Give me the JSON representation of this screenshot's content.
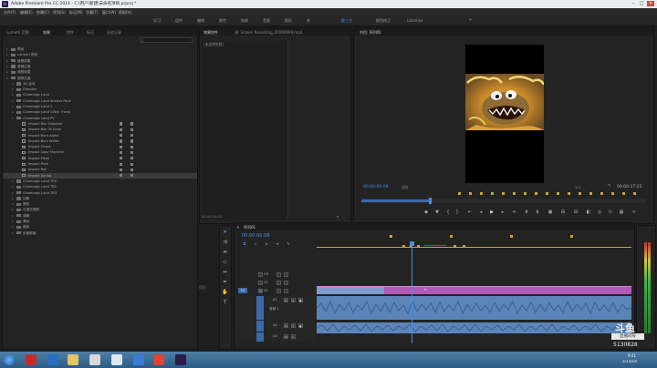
{
  "window": {
    "title": "Adobe Premiere Pro CC 2014 - C:\\用户\\新建\\未命名项目.prproj *",
    "minimize": "–",
    "maximize": "□",
    "close": "✕"
  },
  "menu": [
    "文件(F)",
    "编辑(E)",
    "剪辑(C)",
    "序列(S)",
    "标记(M)",
    "字幕(T)",
    "窗口(W)",
    "帮助(H)"
  ],
  "workspaces": {
    "items": [
      "学习",
      "组件",
      "编辑",
      "颜色",
      "效果",
      "音频",
      "图形",
      "库",
      "第三方",
      "颜色校正",
      "Libraries"
    ],
    "active": "第三方"
  },
  "effects_panel": {
    "tabs": [
      "Lumetri 范围",
      "效果",
      "控件",
      "标记",
      "历史记录"
    ],
    "active_tab": "效果",
    "search_icon": "search-icon",
    "tree": [
      {
        "label": "预设",
        "level": 0,
        "kind": "folder"
      },
      {
        "label": "Lumetri 预设",
        "level": 0,
        "kind": "folder"
      },
      {
        "label": "音频效果",
        "level": 0,
        "kind": "folder"
      },
      {
        "label": "音频过渡",
        "level": 0,
        "kind": "folder"
      },
      {
        "label": "视频效果",
        "level": 0,
        "kind": "folder"
      },
      {
        "label": "视频过渡",
        "level": 0,
        "kind": "folder",
        "open": true
      },
      {
        "label": "3D 运动",
        "level": 1,
        "kind": "folder"
      },
      {
        "label": "Dissolve",
        "level": 1,
        "kind": "folder"
      },
      {
        "label": "Cinemagic Land",
        "level": 1,
        "kind": "folder"
      },
      {
        "label": "Cinemagic Land Shatter Pack",
        "level": 1,
        "kind": "folder"
      },
      {
        "label": "Cinemagic Land 2",
        "level": 1,
        "kind": "folder"
      },
      {
        "label": "Cinemagic Land Glitch Transi",
        "level": 1,
        "kind": "folder"
      },
      {
        "label": "Cinemagic Land PV",
        "level": 1,
        "kind": "folder",
        "open": true
      },
      {
        "label": "Impact Blur Dissolve",
        "level": 2,
        "kind": "fx"
      },
      {
        "label": "Impact Blur To Color",
        "level": 2,
        "kind": "fx"
      },
      {
        "label": "Impact Burn Alpha",
        "level": 2,
        "kind": "fx"
      },
      {
        "label": "Impact Burn White",
        "level": 2,
        "kind": "fx"
      },
      {
        "label": "Impact Chaos",
        "level": 2,
        "kind": "fx"
      },
      {
        "label": "Impact Copy Machine",
        "level": 2,
        "kind": "fx"
      },
      {
        "label": "Impact Flash",
        "level": 2,
        "kind": "fx"
      },
      {
        "label": "Impact Push",
        "level": 2,
        "kind": "fx"
      },
      {
        "label": "Impact Roll",
        "level": 2,
        "kind": "fx"
      },
      {
        "label": "Impact Spring",
        "level": 2,
        "kind": "fx",
        "selected": true
      },
      {
        "label": "Cinemagic Land TRS",
        "level": 1,
        "kind": "folder"
      },
      {
        "label": "Cinemagic Land TR2",
        "level": 1,
        "kind": "folder"
      },
      {
        "label": "Cinemagic Land TR3",
        "level": 1,
        "kind": "folder"
      },
      {
        "label": "划像",
        "level": 1,
        "kind": "folder"
      },
      {
        "label": "擦除",
        "level": 1,
        "kind": "folder"
      },
      {
        "label": "沉浸式视频",
        "level": 1,
        "kind": "folder"
      },
      {
        "label": "溶解",
        "level": 1,
        "kind": "folder"
      },
      {
        "label": "滑动",
        "level": 1,
        "kind": "folder"
      },
      {
        "label": "缩放",
        "level": 1,
        "kind": "folder"
      },
      {
        "label": "页面剥落",
        "level": 1,
        "kind": "folder"
      }
    ]
  },
  "effect_controls": {
    "tabs": [
      "效果控件",
      "源: Screen Recording_20190909.mp4"
    ],
    "active_tab": "效果控件",
    "placeholder": "(未选择剪辑)",
    "time": "00:00:00:00"
  },
  "program_monitor": {
    "tab": "节目: 序列01",
    "timecode": "00:00:00:08",
    "fit": "适合",
    "ratio": "1/2",
    "duration": "00:00:17:22",
    "progress": 0.24,
    "controls": [
      "mark-in-icon",
      "mark-out-icon",
      "go-to-in-icon",
      "step-back-icon",
      "play-icon",
      "step-forward-icon",
      "go-to-out-icon",
      "lift-icon",
      "extract-icon",
      "export-frame-icon",
      "plus-icon"
    ]
  },
  "tools": [
    "selection-tool-icon",
    "track-select-icon",
    "ripple-edit-icon",
    "razor-icon",
    "slip-icon",
    "pen-icon",
    "hand-icon",
    "type-icon"
  ],
  "timeline": {
    "tab": "序列01",
    "timecode": "00:00:00:08",
    "tracks_video": [
      {
        "name": "V3",
        "target": false
      },
      {
        "name": "V2",
        "target": false
      },
      {
        "name": "V1",
        "target": true
      }
    ],
    "tracks_audio": [
      {
        "name": "A1",
        "label": "音频 1"
      },
      {
        "name": "A2",
        "label": ""
      },
      {
        "name": "A3",
        "label": ""
      }
    ],
    "clip_label": "fx",
    "playhead": 0.3
  },
  "left_label": "项目:",
  "watermark": {
    "brand": "斗鱼",
    "sub": "直播间号",
    "id": "5130828"
  },
  "taskbar": {
    "time": "9:31",
    "date": "2019/9/9"
  }
}
